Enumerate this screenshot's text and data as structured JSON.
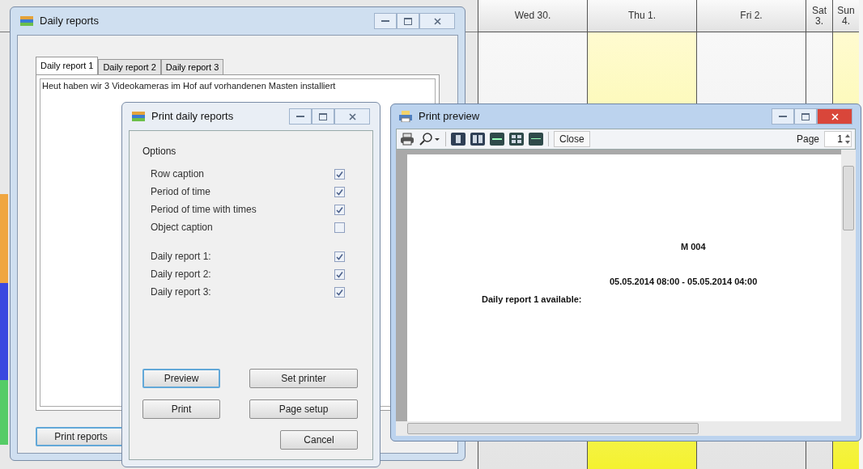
{
  "calendar": {
    "days": [
      {
        "label": "Wed 30.",
        "highlighted": false
      },
      {
        "label": "Thu 1.",
        "highlighted": true
      },
      {
        "label": "Fri 2.",
        "highlighted": false
      },
      {
        "label": "Sat 3.",
        "highlighted": false
      },
      {
        "label": "Sun 4.",
        "highlighted": true
      }
    ]
  },
  "daily_reports_window": {
    "title": "Daily reports",
    "tabs": [
      {
        "label": "Daily report 1",
        "selected": true
      },
      {
        "label": "Daily report 2",
        "selected": false
      },
      {
        "label": "Daily report 3",
        "selected": false
      }
    ],
    "text": "Heut haben wir 3 Videokameras im Hof auf vorhandenen Masten installiert",
    "print_button": "Print reports"
  },
  "print_dialog": {
    "title": "Print daily reports",
    "group_label": "Options",
    "options": [
      {
        "label": "Row caption",
        "checked": true
      },
      {
        "label": "Period of time",
        "checked": true
      },
      {
        "label": "Period of time with times",
        "checked": true
      },
      {
        "label": "Object caption",
        "checked": false
      }
    ],
    "reports": [
      {
        "label": "Daily report 1:",
        "checked": true
      },
      {
        "label": "Daily report 2:",
        "checked": true
      },
      {
        "label": "Daily report 3:",
        "checked": true
      }
    ],
    "buttons": {
      "preview": "Preview",
      "set_printer": "Set printer",
      "print": "Print",
      "page_setup": "Page setup",
      "cancel": "Cancel"
    }
  },
  "preview_window": {
    "title": "Print preview",
    "close_button": "Close",
    "page_label": "Page",
    "page_value": "1",
    "page": {
      "heading": "M 004",
      "period": "05.05.2014 08:00 - 05.05.2014 04:00",
      "note": "Daily report 1 available:"
    }
  }
}
